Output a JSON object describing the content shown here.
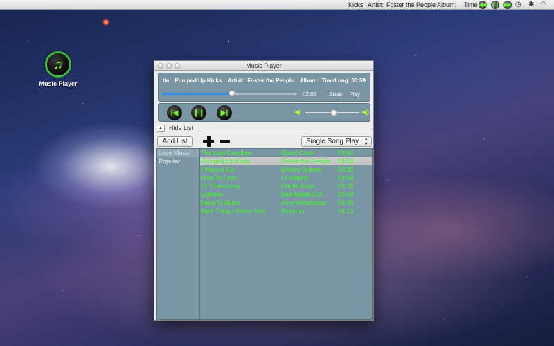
{
  "menubar": {
    "title_label": "Kicks",
    "artist_label": "Artist:",
    "artist_value": "Foster the People",
    "album_label": "Album:",
    "time_label": "Time",
    "icons": [
      "previous-icon",
      "pause-icon",
      "next-icon",
      "time-machine-icon",
      "bluetooth-icon",
      "wifi-icon"
    ]
  },
  "desktop": {
    "app_icon_label": "Music Player"
  },
  "window": {
    "title": "Music Player",
    "now_playing": {
      "title_label": "tle:",
      "title_value": "Pumped Up Kicks",
      "artist_label": "Artist:",
      "artist_value": "Foster the People",
      "album_label": "Album:",
      "timelong_label": "TimeLong:",
      "timelong_value": "03:59",
      "elapsed": "02:05",
      "state_label": "State:",
      "state_value": "Play",
      "progress": 0.52
    },
    "volume": 0.52,
    "hide_list_label": "Hide List",
    "add_list_label": "Add List",
    "play_mode": "Single Song Play",
    "playlists": [
      "Love Music",
      "Popular"
    ],
    "selected_playlist": "Love Music",
    "songs": [
      {
        "title": "The Last Goodbye",
        "artist": "David Cook",
        "duration": "03:00"
      },
      {
        "title": "Pumped Up Kicks",
        "artist": "Foster the People",
        "duration": "03:59"
      },
      {
        "title": "I Wanna Go",
        "artist": "Britney Spears",
        "duration": "03:30"
      },
      {
        "title": "How To Love",
        "artist": "Lil Wayne",
        "duration": "03:58"
      },
      {
        "title": "01 Ghostsong",
        "artist": "Daniel Knox",
        "duration": "03:18"
      },
      {
        "title": "Lighters",
        "artist": "Bad Meets Evil",
        "duration": "05:03"
      },
      {
        "title": "Back To Black",
        "artist": "Amy Winehouse",
        "duration": "03:49"
      },
      {
        "title": "Best Thing I Never Had",
        "artist": "Beyonce",
        "duration": "04:13"
      }
    ],
    "selected_song": "Pumped Up Kicks"
  },
  "colors": {
    "panel": "#7a95a4",
    "song_text": "#3cff1e",
    "accent_green": "#6dff2a",
    "progress": "#3e8ed6"
  }
}
